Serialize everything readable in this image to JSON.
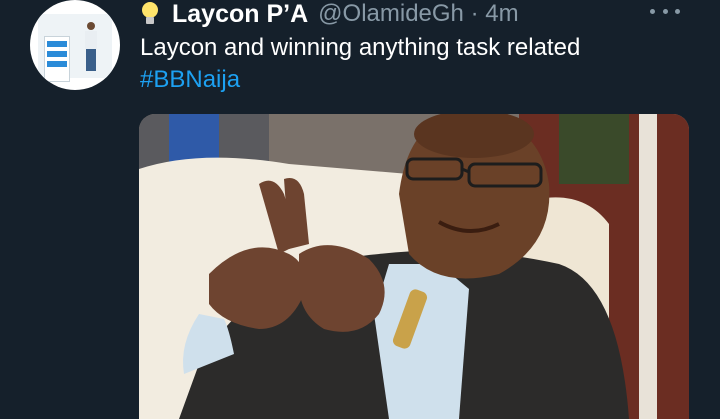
{
  "tweet": {
    "name": "Laycon P’A",
    "handle": "@OlamideGh",
    "separator": "·",
    "time": "4m",
    "text_line1": "Laycon and winning anything task related",
    "hashtag": "#BBNaija",
    "avatar_icon": "profile-photo",
    "name_emoji_icon": "light-bulb-icon",
    "more_icon": "more-options-icon",
    "media_alt": "photo of a smiling man in a dark suit crossing his fingers"
  },
  "colors": {
    "background": "#15202b",
    "text": "#ffffff",
    "secondary": "#8899a6",
    "link": "#1da1f2"
  }
}
